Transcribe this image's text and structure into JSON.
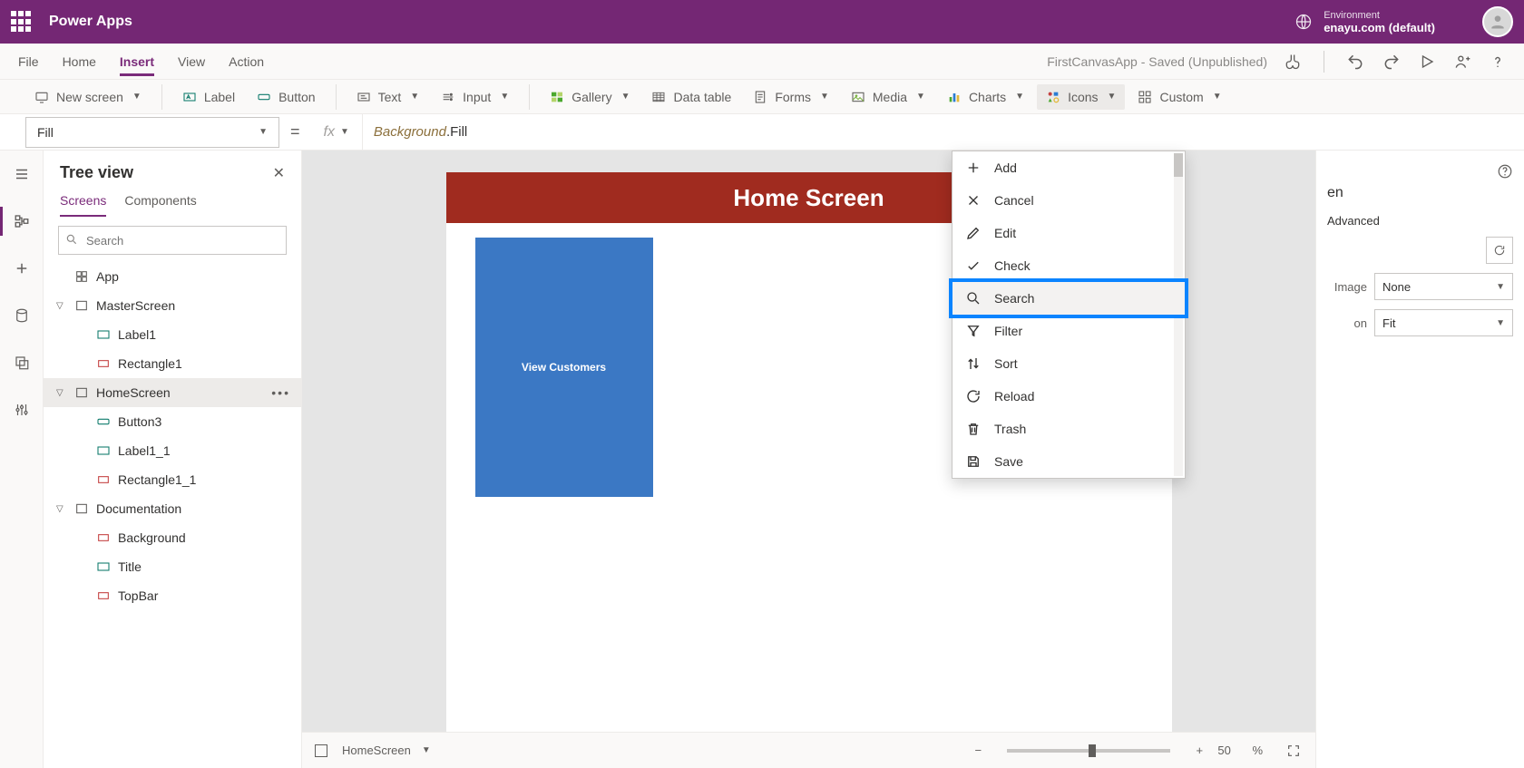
{
  "header": {
    "app_title": "Power Apps",
    "env_label": "Environment",
    "env_value": "enayu.com (default)"
  },
  "menu": {
    "items": [
      "File",
      "Home",
      "Insert",
      "View",
      "Action"
    ],
    "active_index": 2,
    "status": "FirstCanvasApp - Saved (Unpublished)"
  },
  "ribbon": {
    "new_screen": "New screen",
    "label": "Label",
    "button": "Button",
    "text": "Text",
    "input": "Input",
    "gallery": "Gallery",
    "data_table": "Data table",
    "forms": "Forms",
    "media": "Media",
    "charts": "Charts",
    "icons": "Icons",
    "custom": "Custom"
  },
  "formula": {
    "property": "Fill",
    "fx": "fx",
    "ref": "Background",
    "prop": "Fill"
  },
  "tree": {
    "title": "Tree view",
    "tabs": [
      "Screens",
      "Components"
    ],
    "active_tab": 0,
    "search_placeholder": "Search",
    "nodes": {
      "app": "App",
      "master": "MasterScreen",
      "label1": "Label1",
      "rect1": "Rectangle1",
      "home": "HomeScreen",
      "button3": "Button3",
      "label1_1": "Label1_1",
      "rect1_1": "Rectangle1_1",
      "doc": "Documentation",
      "background": "Background",
      "title_node": "Title",
      "topbar": "TopBar"
    }
  },
  "canvas": {
    "screen_title": "Home Screen",
    "card_label": "View Customers"
  },
  "prop_panel": {
    "trunc1": "en",
    "tab": "Advanced",
    "image_label": "Image",
    "image_value": "None",
    "pos_label": "on",
    "pos_value": "Fit"
  },
  "icons_menu": {
    "items": [
      "Add",
      "Cancel",
      "Edit",
      "Check",
      "Search",
      "Filter",
      "Sort",
      "Reload",
      "Trash",
      "Save"
    ],
    "highlight_index": 4
  },
  "statusbar": {
    "screen_name": "HomeScreen",
    "zoom": "50",
    "zoom_unit": "%"
  }
}
